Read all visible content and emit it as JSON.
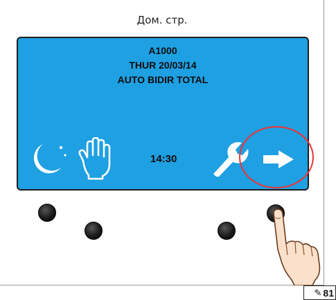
{
  "header": {
    "title": "Дом. стр."
  },
  "display": {
    "line1": "A1000",
    "line2": "THUR 20/03/14",
    "line3": "AUTO BIDIR TOTAL",
    "time": "14:30"
  },
  "icons": [
    "moon-icon",
    "hand-icon",
    "wrench-icon",
    "arrow-right-icon",
    "pencil-icon"
  ],
  "figure_ref": {
    "number": "81",
    "icon": "pencil-icon"
  },
  "colors": {
    "screen": "#1ea0e2",
    "highlight": "#e33333",
    "icon": "#ffffff"
  }
}
